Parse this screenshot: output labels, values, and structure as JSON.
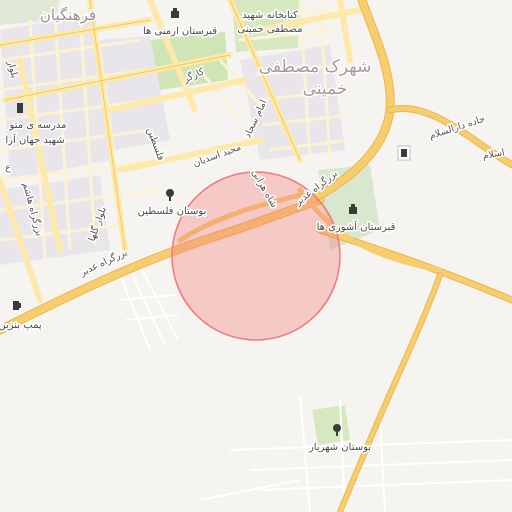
{
  "labels": {
    "district_top": "فرهنگیان",
    "district_center_1": "شهرک مصطفی",
    "district_center_2": "خمینی",
    "cemetery_armeni": "قبرستان ارمنی ها",
    "library_1": "کتابخانه شهید",
    "library_2": "مصطفی خمینی",
    "school_1": "مدرسه ی متو",
    "school_2": "شهید جهان آرا",
    "park_palestine": "بوستان فلسطین",
    "cemetery_ashouri": "قبرستان آشوری ها",
    "park_shahriar": "بوستان شهریار",
    "gas_station": "پمپ بنزین",
    "road_ghadir_east": "بزرگراه غدیر",
    "road_ghadir_west": "بزرگراه غدیر",
    "road_karegar": "کارگر",
    "road_emam_sajjad": "امام سجاد",
    "road_majid_asadian": "مجید اسدیان",
    "road_shahid_harati": "شاه هراتی",
    "road_falestin": "فلسطین",
    "road_goli": "بلوار گلها",
    "road_jade_dar": "جاده دارالسلام",
    "road_islam": "اسلام",
    "road_mehr": "بزرگراه هاشم",
    "road_left_top": "بلوار",
    "road_left_mid": "ع"
  },
  "marker": {
    "type": "radius-circle",
    "color": "#f07878"
  },
  "icons": {
    "cemetery": "cemetery-icon",
    "park": "tree-icon",
    "fuel": "fuel-pump-icon",
    "school": "school-icon"
  },
  "colors": {
    "background": "#f6f4f0",
    "road_major": "#f8cd70",
    "road_minor": "#fde9a9",
    "green": "#cfe5b6",
    "block": "#e9e6ec"
  }
}
